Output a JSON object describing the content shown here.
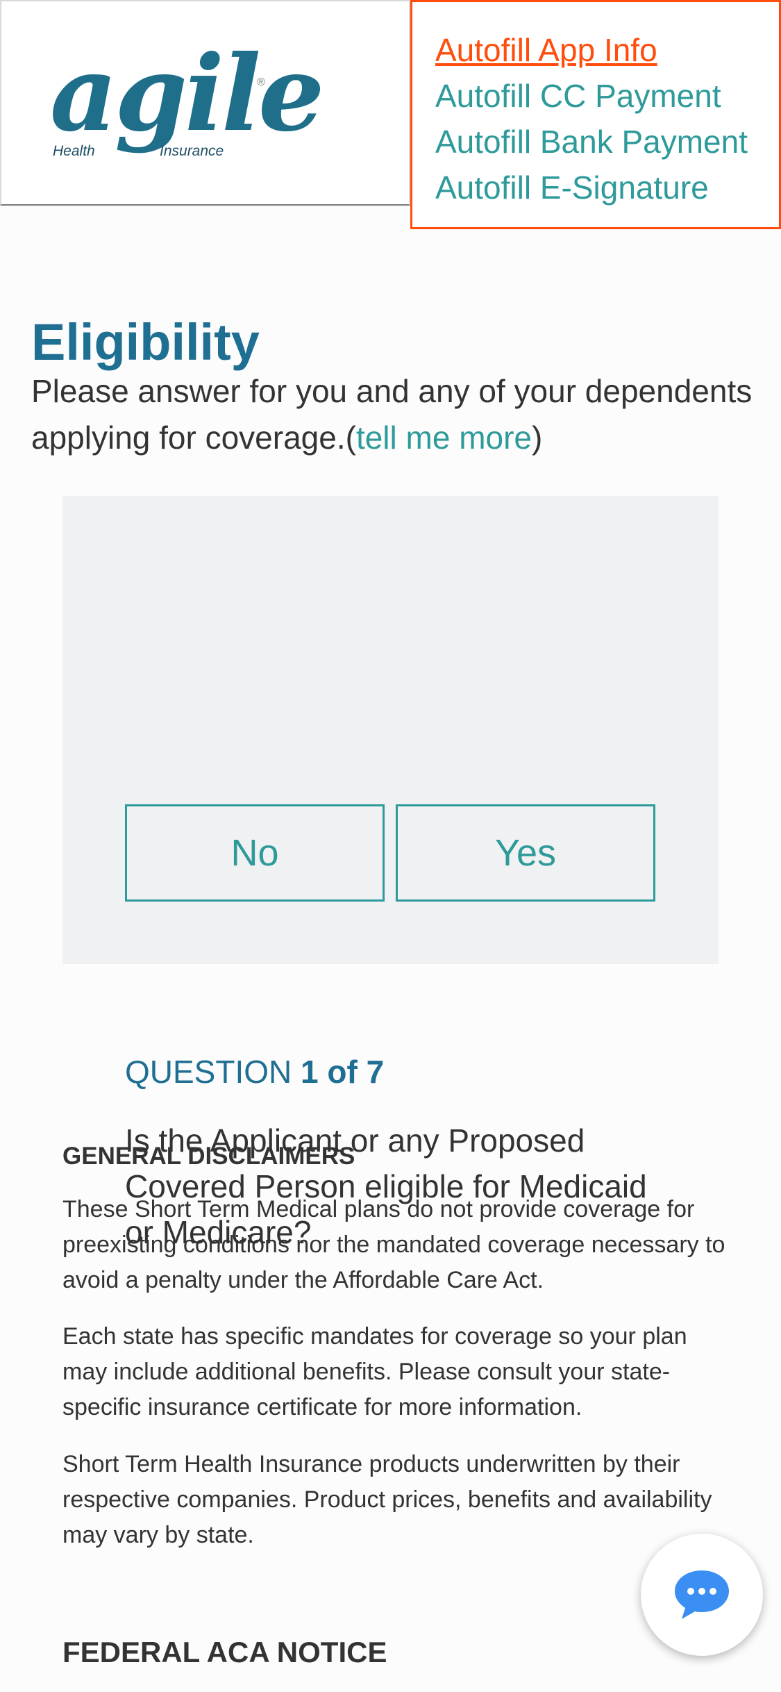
{
  "header": {
    "logo": {
      "word": "agile",
      "registered": "®",
      "sub_left": "Health",
      "sub_right": "Insurance"
    },
    "autofill_menu": [
      {
        "label": "Autofill App Info",
        "active": true
      },
      {
        "label": "Autofill CC Payment",
        "active": false
      },
      {
        "label": "Autofill Bank Payment",
        "active": false
      },
      {
        "label": "Autofill E-Signature",
        "active": false
      }
    ]
  },
  "eligibility": {
    "title": "Eligibility",
    "intro_text": "Please answer for you and any of your dependents applying for coverage.(",
    "tell_more": "tell me more",
    "intro_close": ")"
  },
  "question": {
    "counter_prefix": "QUESTION ",
    "counter_value": "1 of 7",
    "text": "Is the Applicant or any Proposed Covered Person eligible for Medicaid or Medicare?",
    "answers": {
      "no": "No",
      "yes": "Yes"
    }
  },
  "disclaimers": {
    "heading": "GENERAL DISCLAIMERS",
    "paragraphs": [
      "These Short Term Medical plans do not provide coverage for preexisting conditions nor the mandated coverage necessary to avoid a penalty under the Affordable Care Act.",
      "Each state has specific mandates for coverage so your plan may include additional benefits. Please consult your state-specific insurance certificate for more information.",
      "Short Term Health Insurance products underwritten by their respective companies. Product prices, benefits and availability may vary by state."
    ]
  },
  "aca_notice": {
    "heading": "FEDERAL ACA NOTICE"
  },
  "chat": {
    "icon": "chat-bubble-icon"
  },
  "colors": {
    "brand_blue": "#1f6f93",
    "teal": "#2e9a9a",
    "active_orange": "#ff4d0d",
    "card_bg": "#f0f1f2",
    "chat_blue": "#3b8ff3"
  }
}
